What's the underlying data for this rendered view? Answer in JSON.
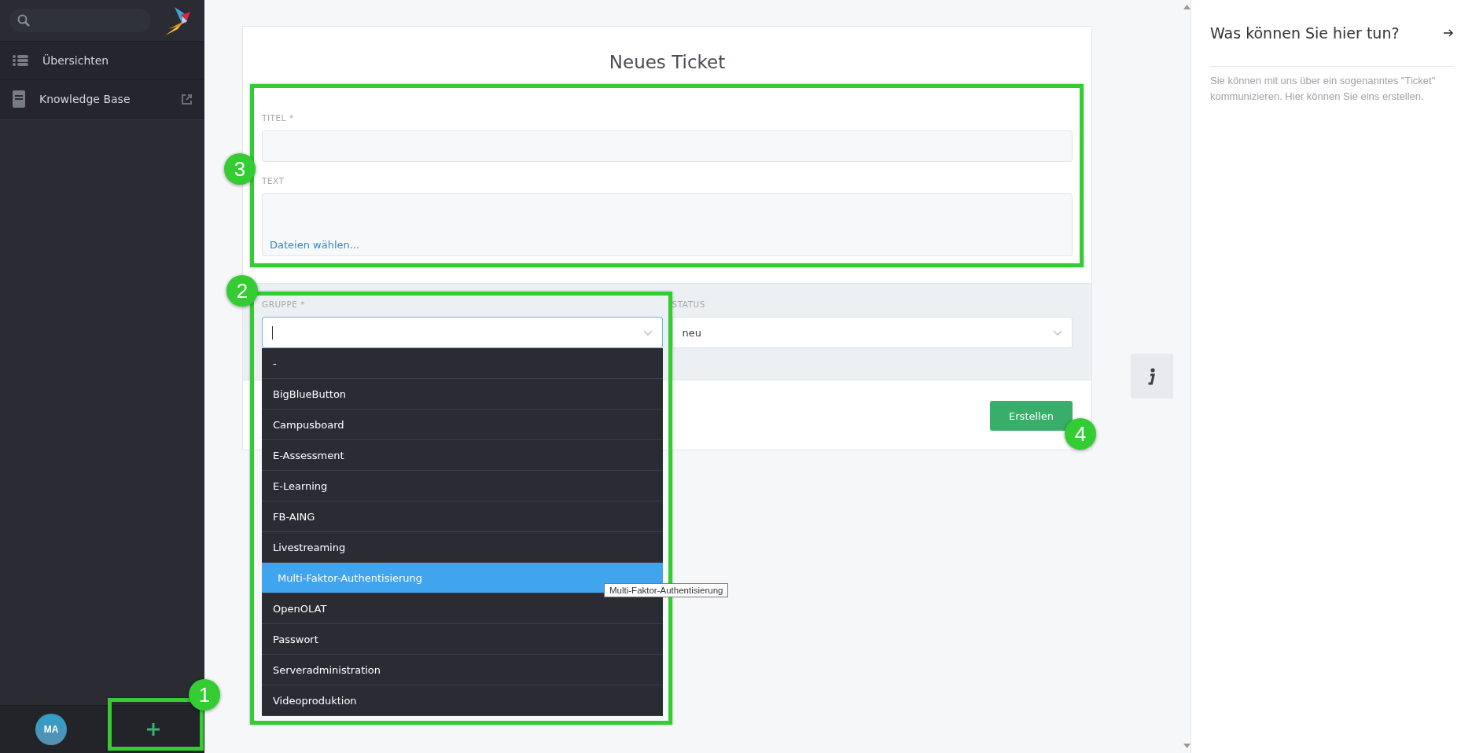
{
  "sidebar": {
    "items": [
      {
        "label": "Übersichten",
        "kind": "list"
      },
      {
        "label": "Knowledge Base",
        "kind": "external"
      }
    ],
    "user": {
      "initials": "MA"
    }
  },
  "form": {
    "title": "Neues Ticket",
    "title_field": {
      "label": "TITEL *"
    },
    "text_field": {
      "label": "TEXT",
      "attach_link": "Dateien wählen..."
    },
    "group": {
      "label": "GRUPPE *",
      "focused": true,
      "options": [
        {
          "label": "-",
          "selected": false
        },
        {
          "label": "BigBlueButton",
          "selected": false
        },
        {
          "label": "Campusboard",
          "selected": false
        },
        {
          "label": "E-Assessment",
          "selected": false
        },
        {
          "label": "E-Learning",
          "selected": false
        },
        {
          "label": "FB-AING",
          "selected": false
        },
        {
          "label": "Livestreaming",
          "selected": false
        },
        {
          "label": "Multi-Faktor-Authentisierung",
          "selected": true
        },
        {
          "label": "OpenOLAT",
          "selected": false
        },
        {
          "label": "Passwort",
          "selected": false
        },
        {
          "label": "Serveradministration",
          "selected": false
        },
        {
          "label": "Videoproduktion",
          "selected": false
        }
      ]
    },
    "status": {
      "label": "STATUS",
      "value": "neu"
    },
    "submit": "Erstellen"
  },
  "tooltip": "Multi-Faktor-Authentisierung",
  "help": {
    "title": "Was können Sie hier tun?",
    "text": "Sie können mit uns über ein sogenanntes \"Ticket\" kommunizieren. Hier können Sie eins erstellen."
  },
  "annotations": [
    {
      "number": "1"
    },
    {
      "number": "2"
    },
    {
      "number": "3"
    },
    {
      "number": "4"
    }
  ]
}
